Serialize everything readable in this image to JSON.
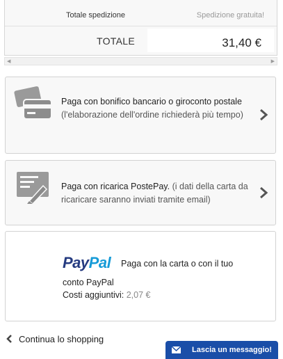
{
  "totals": {
    "shipping_label": "Totale spedizione",
    "shipping_value": "Spedizione gratuita!",
    "total_label": "TOTALE",
    "total_value": "31,40 €"
  },
  "payment_options": [
    {
      "title": "Paga con bonifico bancario o giroconto postale",
      "note": "(l'elaborazione dell'ordine richiederà più tempo)",
      "icon": "credit-card-icon"
    },
    {
      "title": "Paga con ricarica PostePay.",
      "note": "(i dati della carta da ricaricare saranno inviati tramite email)",
      "icon": "signed-document-icon"
    },
    {
      "logo_pay": "Pay",
      "logo_pal": "Pal",
      "line1": "Paga con la carta o con il tuo",
      "line2": "conto PayPal",
      "fee_label": "Costi aggiuntivi:",
      "fee_value": "2,07 €"
    }
  ],
  "footer": {
    "continue_label": "Continua lo shopping",
    "message_button_label": "Lascia un messaggio!"
  },
  "colors": {
    "paypal_dark": "#253b80",
    "paypal_light": "#179bd7",
    "chat_button": "#1a4ea8"
  }
}
